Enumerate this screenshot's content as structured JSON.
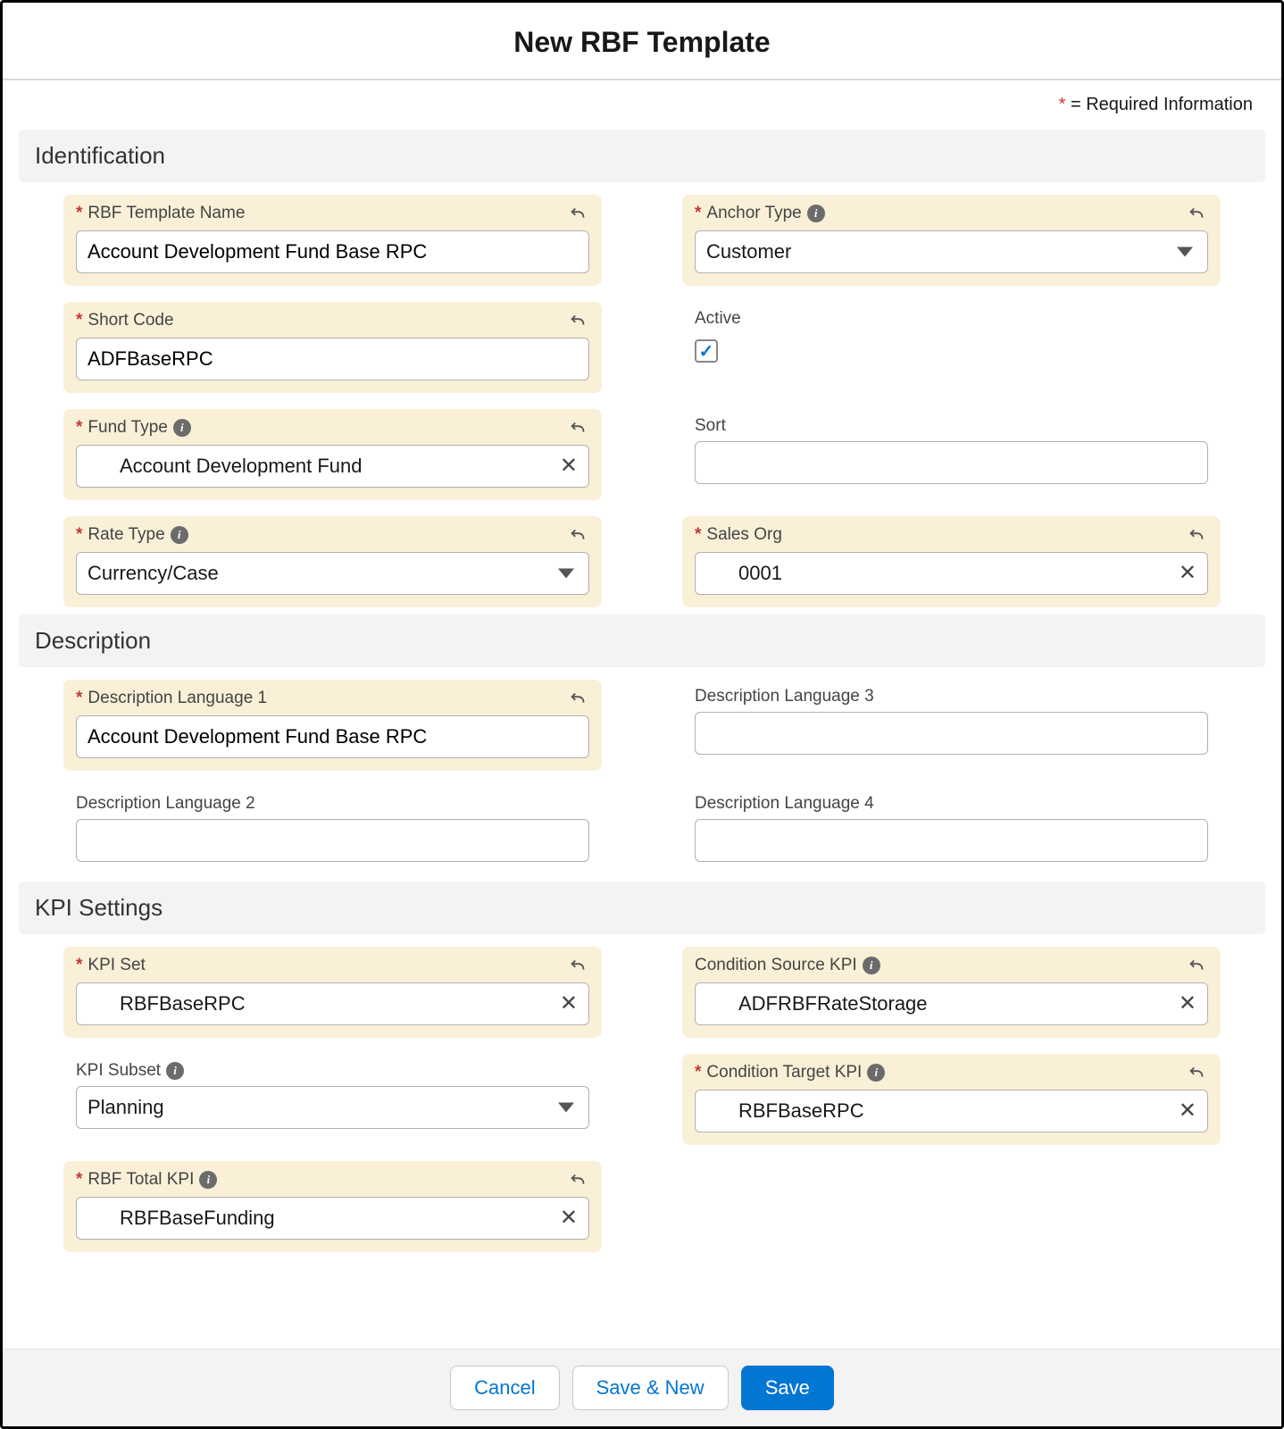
{
  "title": "New RBF Template",
  "required_note": "= Required Information",
  "sections": {
    "identification": "Identification",
    "description": "Description",
    "kpi": "KPI Settings"
  },
  "fields": {
    "rbf_template_name": {
      "label": "RBF Template Name",
      "value": "Account Development Fund Base RPC"
    },
    "anchor_type": {
      "label": "Anchor Type",
      "value": "Customer"
    },
    "short_code": {
      "label": "Short Code",
      "value": "ADFBaseRPC"
    },
    "active": {
      "label": "Active",
      "checked": true
    },
    "fund_type": {
      "label": "Fund Type",
      "value": "Account Development Fund"
    },
    "sort": {
      "label": "Sort",
      "value": ""
    },
    "rate_type": {
      "label": "Rate Type",
      "value": "Currency/Case"
    },
    "sales_org": {
      "label": "Sales Org",
      "value": "0001"
    },
    "desc1": {
      "label": "Description Language 1",
      "value": "Account Development Fund Base RPC"
    },
    "desc2": {
      "label": "Description Language 2",
      "value": ""
    },
    "desc3": {
      "label": "Description Language 3",
      "value": ""
    },
    "desc4": {
      "label": "Description Language 4",
      "value": ""
    },
    "kpi_set": {
      "label": "KPI Set",
      "value": "RBFBaseRPC"
    },
    "cond_src_kpi": {
      "label": "Condition Source KPI",
      "value": "ADFRBFRateStorage"
    },
    "kpi_subset": {
      "label": "KPI Subset",
      "value": "Planning"
    },
    "cond_tgt_kpi": {
      "label": "Condition Target KPI",
      "value": "RBFBaseRPC"
    },
    "rbf_total_kpi": {
      "label": "RBF Total KPI",
      "value": "RBFBaseFunding"
    }
  },
  "buttons": {
    "cancel": "Cancel",
    "save_new": "Save & New",
    "save": "Save"
  }
}
